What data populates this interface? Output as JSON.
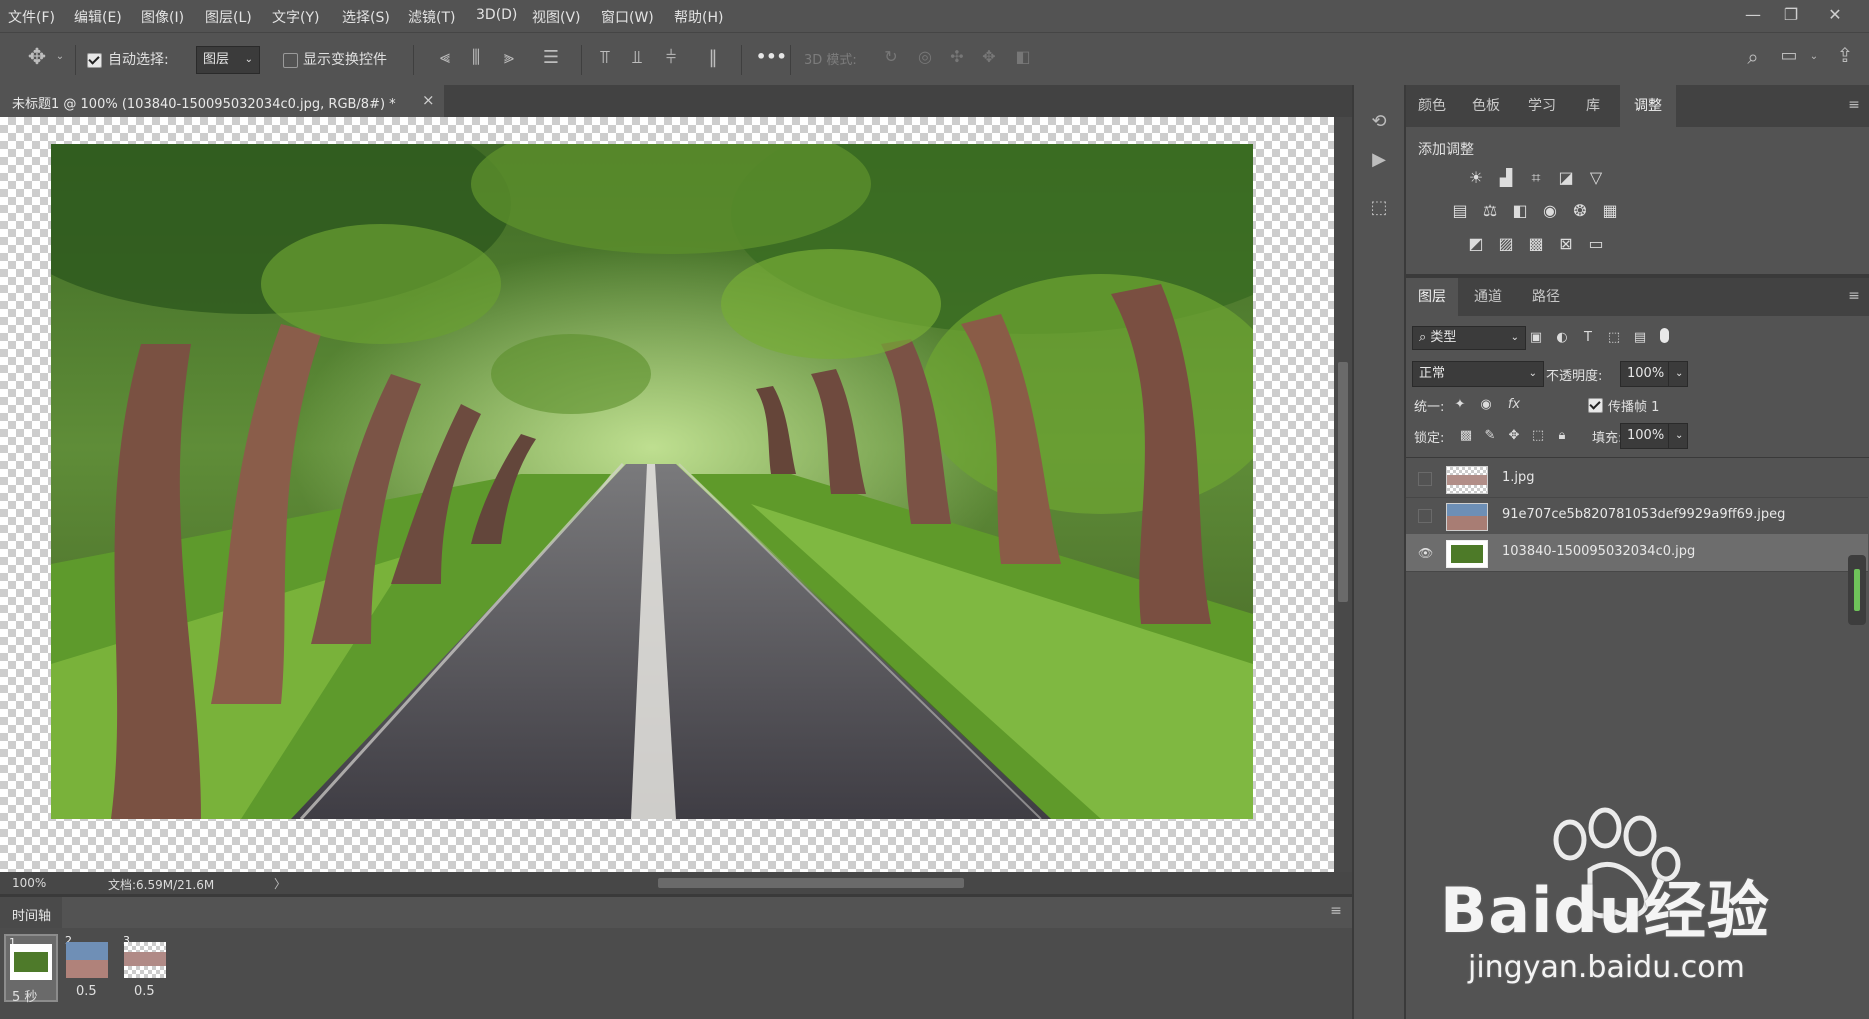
{
  "menu": [
    "文件(F)",
    "编辑(E)",
    "图像(I)",
    "图层(L)",
    "文字(Y)",
    "选择(S)",
    "滤镜(T)",
    "3D(D)",
    "视图(V)",
    "窗口(W)",
    "帮助(H)"
  ],
  "options": {
    "auto_select_label": "自动选择:",
    "auto_select_target": "图层",
    "show_transform_label": "显示变换控件",
    "mode_3d_label": "3D 模式:",
    "more_label": "•••"
  },
  "document": {
    "tab_title": "未标题1 @ 100% (103840-150095032034c0.jpg, RGB/8#) *",
    "close_glyph": "×"
  },
  "status": {
    "zoom": "100%",
    "doc_size": "文档:6.59M/21.6M",
    "arrow": "〉"
  },
  "timeline": {
    "title": "时间轴",
    "frames": [
      {
        "num": "1",
        "duration": "5 秒",
        "selected": true
      },
      {
        "num": "2",
        "duration": "0.5",
        "selected": false
      },
      {
        "num": "3",
        "duration": "0.5",
        "selected": false
      }
    ]
  },
  "adjust_panel": {
    "tabs": [
      "颜色",
      "色板",
      "学习",
      "库",
      "调整"
    ],
    "active_tab": "调整",
    "add_label": "添加调整"
  },
  "layers_panel": {
    "tabs": [
      "图层",
      "通道",
      "路径"
    ],
    "active_tab": "图层",
    "filter_label": "类型",
    "blend_mode": "正常",
    "opacity_label": "不透明度:",
    "opacity_value": "100%",
    "unify_label": "统一:",
    "propagate_label": "传播帧 1",
    "lock_label": "锁定:",
    "fill_label": "填充:",
    "fill_value": "100%",
    "layers": [
      {
        "name": "1.jpg",
        "visible": false,
        "selected": false
      },
      {
        "name": "91e707ce5b820781053def9929a9ff69.jpeg",
        "visible": false,
        "selected": false
      },
      {
        "name": "103840-150095032034c0.jpg",
        "visible": true,
        "selected": true
      }
    ]
  },
  "watermark": {
    "brand": "Baidu经验",
    "url": "jingyan.baidu.com"
  },
  "colors": {
    "ui_bg": "#535353",
    "panel_dark": "#424242",
    "selected_row": "#6d6d6d",
    "accent_green": "#6fc35a"
  }
}
